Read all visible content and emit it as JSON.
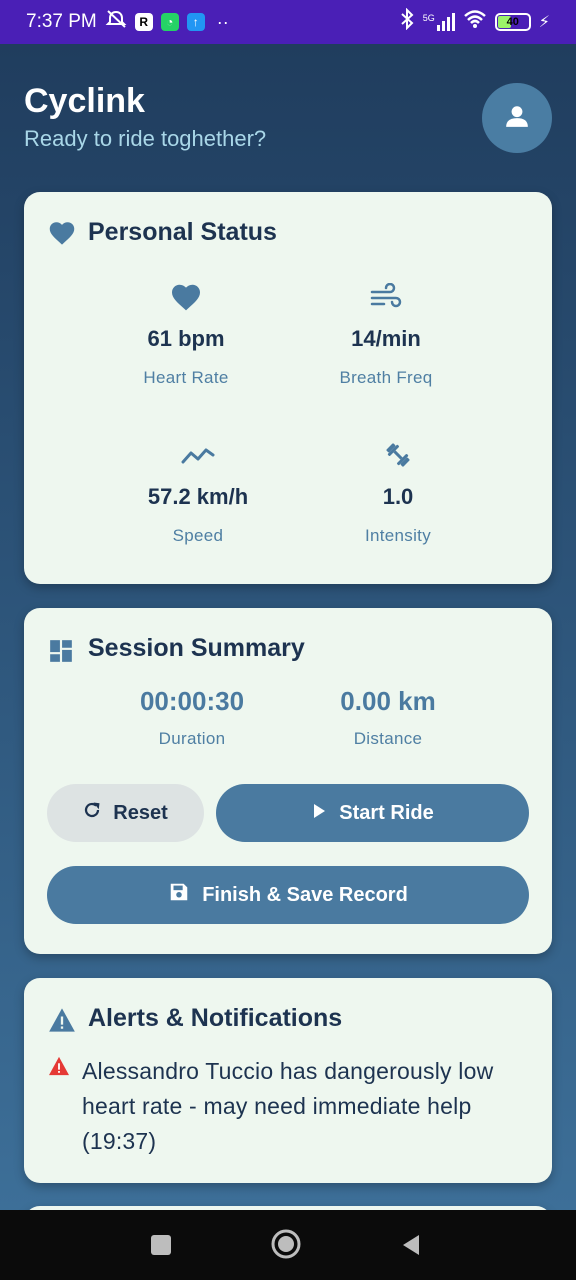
{
  "status_bar": {
    "time": "7:37 PM",
    "network": "5G",
    "battery": "40",
    "battery_level": 0.4,
    "icons": [
      "mute-icon",
      "r-app-icon",
      "whatsapp-icon",
      "upload-icon",
      "more-icon",
      "bluetooth-icon",
      "signal-icon",
      "wifi-icon",
      "battery-icon",
      "charging-icon"
    ]
  },
  "header": {
    "title": "Cyclink",
    "subtitle": "Ready to ride toghether?",
    "avatar_icon": "person-icon"
  },
  "personal_status": {
    "title": "Personal Status",
    "icon": "heart-icon",
    "metrics": [
      {
        "icon": "heart-icon",
        "value": "61 bpm",
        "label": "Heart Rate"
      },
      {
        "icon": "wind-icon",
        "value": "14/min",
        "label": "Breath Freq"
      },
      {
        "icon": "trending-icon",
        "value": "57.2 km/h",
        "label": "Speed"
      },
      {
        "icon": "dumbbell-icon",
        "value": "1.0",
        "label": "Intensity"
      }
    ]
  },
  "session_summary": {
    "title": "Session Summary",
    "icon": "dashboard-icon",
    "duration_value": "00:00:30",
    "duration_label": "Duration",
    "distance_value": "0.00 km",
    "distance_label": "Distance",
    "reset_label": "Reset",
    "start_label": "Start Ride",
    "finish_label": "Finish & Save Record"
  },
  "alerts": {
    "title": "Alerts & Notifications",
    "icon": "warning-icon",
    "items": [
      {
        "icon": "warning-icon",
        "text": "Alessandro Tuccio has dangerously low heart rate - may need immediate help (19:37)",
        "color": "#e53935"
      }
    ]
  },
  "colors": {
    "accent": "#4a7aa0",
    "card_bg": "#eef7ef",
    "title_text": "#1d3350",
    "status_bar": "#4a1fb6"
  }
}
